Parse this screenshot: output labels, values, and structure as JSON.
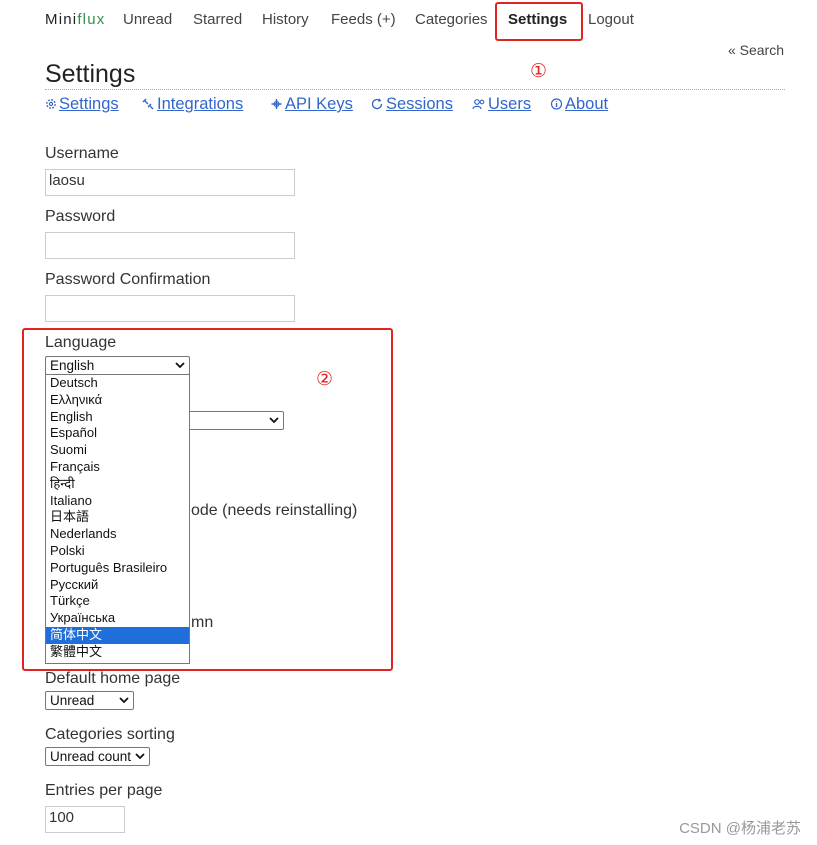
{
  "header": {
    "logo_main": "Mini",
    "logo_accent": "flux",
    "nav": [
      "Unread",
      "Starred",
      "History",
      "Feeds (+)",
      "Categories",
      "Settings",
      "Logout"
    ],
    "search_link": "« Search"
  },
  "page": {
    "title": "Settings",
    "submenu": [
      "Settings",
      "Integrations",
      "API Keys",
      "Sessions",
      "Users",
      "About"
    ]
  },
  "form": {
    "username_label": "Username",
    "username_value": "laosu",
    "password_label": "Password",
    "password_confirm_label": "Password Confirmation",
    "language_label": "Language",
    "language_selected": "English",
    "language_options": [
      "Deutsch",
      "Ελληνικά",
      "English",
      "Español",
      "Suomi",
      "Français",
      "हिन्दी",
      "Italiano",
      "日本語",
      "Nederlands",
      "Polski",
      "Português Brasileiro",
      "Русский",
      "Türkçe",
      "Українська",
      "简体中文",
      "繁體中文"
    ],
    "language_highlighted": "简体中文",
    "hidden_text_1": "ode (needs reinstalling)",
    "hidden_text_2": "mn",
    "home_page_label": "Default home page",
    "home_page_value": "Unread",
    "categories_sorting_label": "Categories sorting",
    "categories_sorting_value": "Unread count",
    "entries_per_page_label": "Entries per page",
    "entries_per_page_value": "100"
  },
  "annotations": {
    "marker_1": "①",
    "marker_2": "②",
    "color": "#e02424"
  },
  "watermark": "CSDN @杨浦老苏"
}
